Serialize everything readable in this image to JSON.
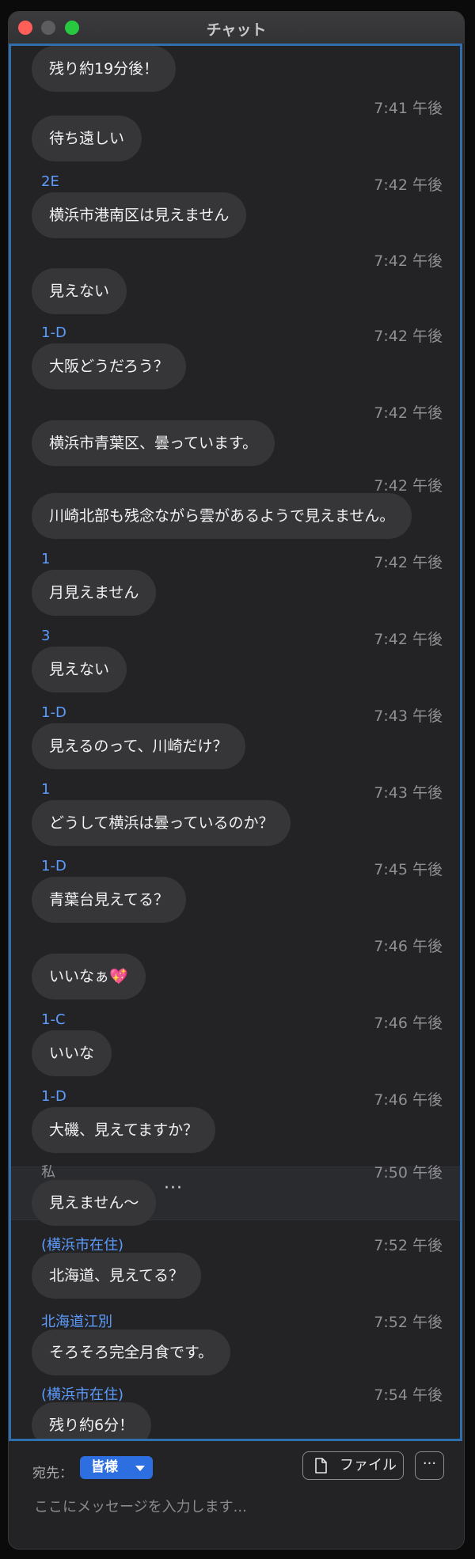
{
  "window": {
    "title": "チャット"
  },
  "messages": [
    {
      "sender": "",
      "time": "",
      "text": "残り約19分後！"
    },
    {
      "sender": "",
      "time": "7:41 午後",
      "text": "待ち遠しい"
    },
    {
      "sender": "2E",
      "time": "7:42 午後",
      "text": "横浜市港南区は見えません"
    },
    {
      "sender": "",
      "time": "7:42 午後",
      "text": "見えない"
    },
    {
      "sender": "1-D",
      "time": "7:42 午後",
      "text": "大阪どうだろう？"
    },
    {
      "sender": "",
      "time": "7:42 午後",
      "text": "横浜市青葉区、曇っています。"
    },
    {
      "sender": "",
      "time": "7:42 午後",
      "text": "川崎北部も残念ながら雲があるようで見えません。"
    },
    {
      "sender": "1",
      "time": "7:42 午後",
      "text": "月見えません"
    },
    {
      "sender": "3",
      "time": "7:42 午後",
      "text": "見えない"
    },
    {
      "sender": "1-D",
      "time": "7:43 午後",
      "text": "見えるのって、川崎だけ？"
    },
    {
      "sender": "1",
      "time": "7:43 午後",
      "text": "どうして横浜は曇っているのか？"
    },
    {
      "sender": "1-D",
      "time": "7:45 午後",
      "text": "青葉台見えてる？"
    },
    {
      "sender": "",
      "time": "7:46 午後",
      "text": "いいなぁ💖"
    },
    {
      "sender": "1-C",
      "time": "7:46 午後",
      "text": "いいな"
    },
    {
      "sender": "1-D",
      "time": "7:46 午後",
      "text": "大磯、見えてますか？"
    },
    {
      "sender": "私",
      "time": "7:50 午後",
      "text": "見えません〜"
    },
    {
      "sender": "(横浜市在住)",
      "time": "7:52 午後",
      "text": "北海道、見えてる？"
    },
    {
      "sender": "北海道江別",
      "time": "7:52 午後",
      "text": "そろそろ完全月食です。"
    },
    {
      "sender": "(横浜市在住)",
      "time": "7:54 午後",
      "text": "残り約6分！"
    }
  ],
  "selected_message_actions": {
    "more_label": "···"
  },
  "composer": {
    "to_label": "宛先：",
    "recipient": "皆様",
    "file_label": "ファイル",
    "more_label": "···",
    "placeholder": "ここにメッセージを入力します..."
  },
  "colors": {
    "accent": "#2d6fe0",
    "sender": "#5c9cff",
    "bubble": "#363638",
    "background": "#232325"
  }
}
